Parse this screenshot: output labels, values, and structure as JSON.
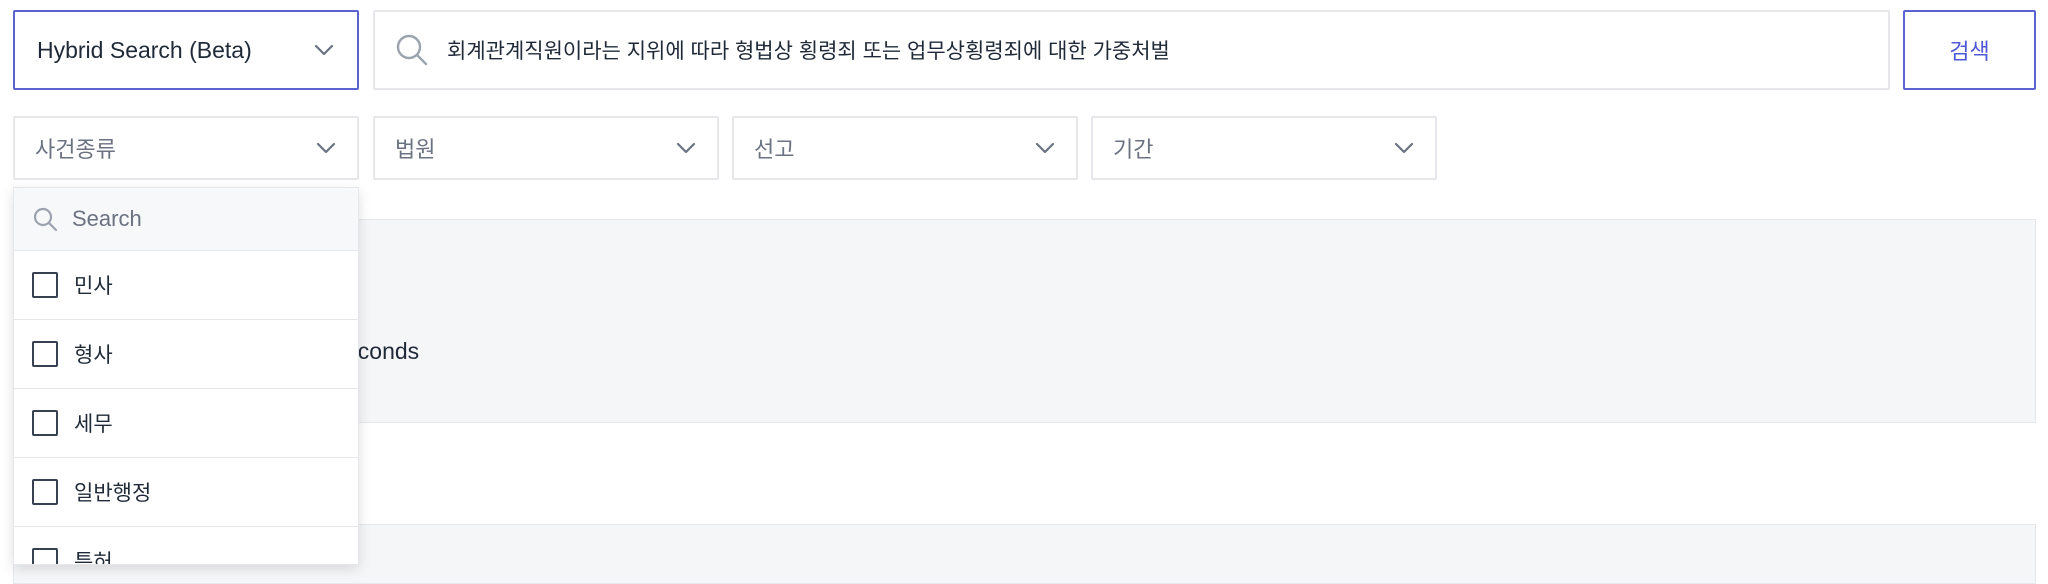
{
  "search_mode": {
    "selected": "Hybrid Search (Beta)"
  },
  "search": {
    "query": "회계관계직원이라는 지위에 따라 형법상 횡령죄 또는 업무상횡령죄에 대한 가중처벌"
  },
  "search_button": {
    "label": "검색"
  },
  "filters": [
    {
      "label": "사건종류"
    },
    {
      "label": "법원"
    },
    {
      "label": "선고"
    },
    {
      "label": "기간"
    }
  ],
  "dropdown": {
    "search_placeholder": "Search",
    "options": [
      {
        "label": "민사",
        "checked": false
      },
      {
        "label": "형사",
        "checked": false
      },
      {
        "label": "세무",
        "checked": false
      },
      {
        "label": "일반행정",
        "checked": false
      },
      {
        "label": "특허",
        "checked": false
      }
    ]
  },
  "result_panel": {
    "partial_text": "econds"
  },
  "colors": {
    "accent": "#5b63d3",
    "border": "#e5e7eb",
    "panel_bg": "#f5f6f8"
  },
  "icons": {
    "search": "search-icon",
    "chevron": "chevron-down-icon"
  }
}
